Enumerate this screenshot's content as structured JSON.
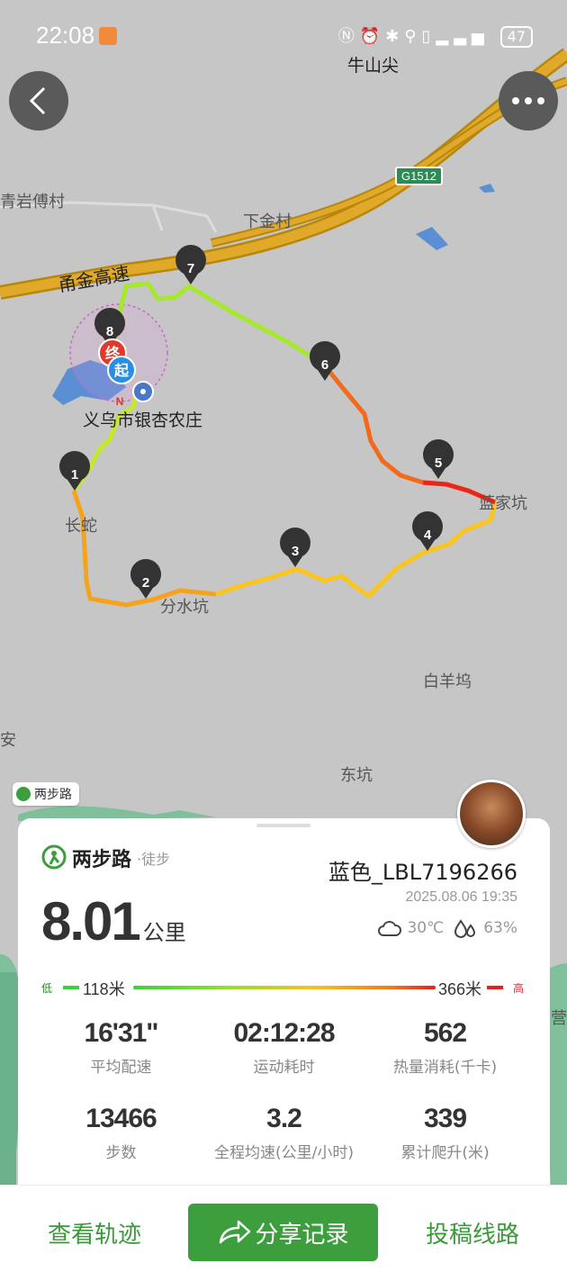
{
  "status_bar": {
    "time": "22:08",
    "battery": "47"
  },
  "map": {
    "labels": {
      "niushanjian": "牛山尖",
      "qingyan": "青岩傅村",
      "xiajin": "下金村",
      "yongjin": "甬金高速",
      "g1512": "G1512",
      "nongzhuang": "义乌市银杏农庄",
      "changshe": "长蛇",
      "fenshuikeng": "分水坑",
      "lanjiakeng": "蓝家坑",
      "baiyangwu": "白羊坞",
      "dongkeng": "东坑",
      "an": "安",
      "ying": "营"
    },
    "markers": [
      "1",
      "2",
      "3",
      "4",
      "5",
      "6",
      "7",
      "8"
    ],
    "start_label": "起",
    "end_label": "终",
    "north_label": "N",
    "brand_tag": "两步路"
  },
  "card": {
    "app_name": "两步路",
    "activity": "·徒步",
    "username": "蓝色_LBL7196266",
    "datetime": "2025.08.06 19:35",
    "temperature": "30℃",
    "humidity": "63%",
    "distance": "8.01",
    "distance_unit": "公里",
    "elevation": {
      "low_label": "低",
      "high_label": "高",
      "min": "118米",
      "max": "366米"
    },
    "stats": [
      {
        "value": "16'31\"",
        "label": "平均配速"
      },
      {
        "value": "02:12:28",
        "label": "运动耗时"
      },
      {
        "value": "562",
        "label": "热量消耗(千卡)"
      },
      {
        "value": "13466",
        "label": "步数"
      },
      {
        "value": "3.2",
        "label": "全程均速(公里/小时)"
      },
      {
        "value": "339",
        "label": "累计爬升(米)"
      }
    ]
  },
  "bottom_bar": {
    "view_track": "查看轨迹",
    "share": "分享记录",
    "submit_route": "投稿线路"
  },
  "colors": {
    "accent_green": "#3d9e3d",
    "highway": "#d4a017",
    "track_low": "#8ee02c",
    "track_high": "#e81d1d"
  }
}
